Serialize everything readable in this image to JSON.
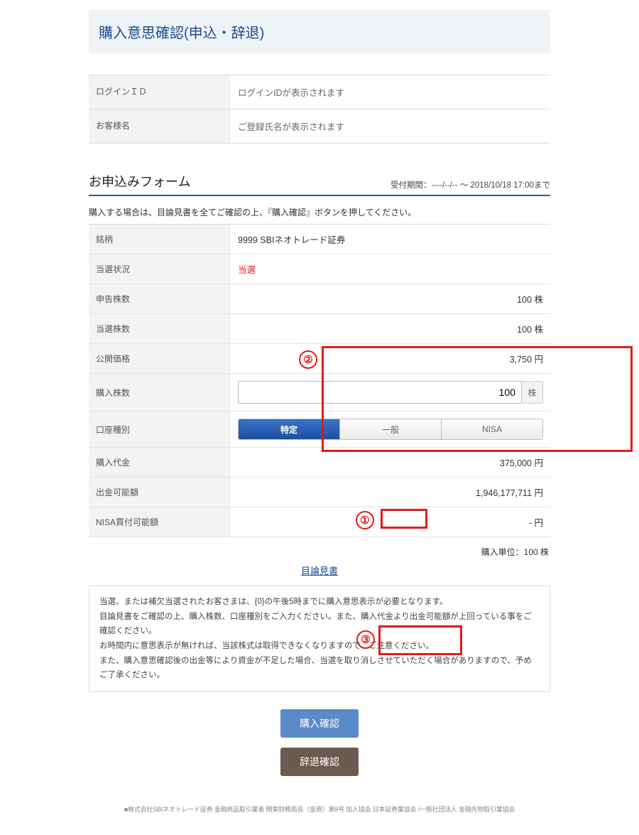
{
  "page_title": "購入意思確認(申込・辞退)",
  "user_info": {
    "login_id_label": "ログインＩＤ",
    "login_id_value": "ログインIDが表示されます",
    "name_label": "お客様名",
    "name_value": "ご登録氏名が表示されます"
  },
  "form": {
    "section_title": "お申込みフォーム",
    "period": "受付期間：----/--/-- ～ 2018/10/18 17:00まで",
    "instruction": "購入する場合は、目論見書を全てご確認の上、『購入確認』ボタンを押してください。",
    "rows": {
      "issue_label": "銘柄",
      "issue_value": "9999  SBIネオトレード証券",
      "status_label": "当選状況",
      "status_value": "当選",
      "declared_label": "申告株数",
      "declared_value": "100 株",
      "allotted_label": "当選株数",
      "allotted_value": "100 株",
      "price_label": "公開価格",
      "price_value": "3,750 円",
      "qty_label": "購入株数",
      "qty_value": "100",
      "qty_unit": "株",
      "account_label": "口座種別",
      "tabs": {
        "tokutei": "特定",
        "ippan": "一般",
        "nisa": "NISA"
      },
      "amount_label": "購入代金",
      "amount_value": "375,000 円",
      "withdraw_label": "出金可能額",
      "withdraw_value": "1,946,177,711 円",
      "nisa_label": "NISA買付可能額",
      "nisa_value": "- 円"
    },
    "purchase_unit": "購入単位：100 株",
    "prospectus_link": "目論見書",
    "notice": "当選、または補欠当選されたお客さまは、{0}の午後5時までに購入意思表示が必要となります。\n目論見書をご確認の上、購入株数、口座種別をご入力ください。また、購入代金より出金可能額が上回っている事をご確認ください。\nお時間内に意思表示が無ければ、当該株式は取得できなくなりますので、ご注意ください。\nまた、購入意思確認後の出金等により資金が不足した場合、当選を取り消しさせていただく場合がありますので、予めご了承ください。",
    "buy_button": "購入確認",
    "decline_button": "辞退確認"
  },
  "badges": {
    "b1": "①",
    "b2": "②",
    "b3": "③"
  },
  "footer": "■株式会社SBIネオトレード証券 金融商品取引業者 関東財務局長（金商）第8号 加入協会 日本証券業協会 /一般社団法人 金融先物取引業協会"
}
